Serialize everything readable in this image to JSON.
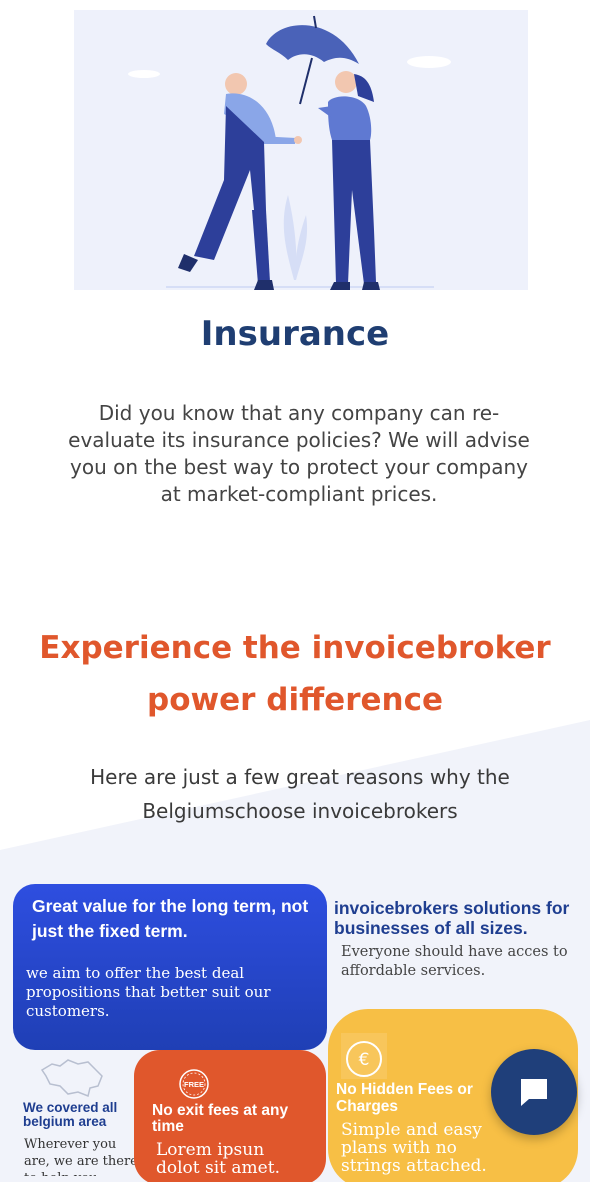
{
  "hero": {
    "illustration": "insurance-umbrella-illustration"
  },
  "insurance": {
    "title": "Insurance",
    "body": "Did you know that any company can re-evaluate its insurance policies? We will advise you on the best way to protect your company at market-compliant prices."
  },
  "experience": {
    "title_line1": "Experience the invoicebroker",
    "title_line2": "power difference",
    "subtitle_line1": "Here are just a few great reasons why the",
    "subtitle_line2": "Belgiumschoose invoicebrokers"
  },
  "cards": {
    "value": {
      "title": "Great value for the long term, not just the fixed term.",
      "body": "we aim to offer the best deal propositions that better suit our customers."
    },
    "solutions": {
      "title": "invoicebrokers solutions for businesses of all sizes.",
      "body": "Everyone should have acces to affordable services."
    },
    "belgium": {
      "icon": "belgium-map-icon",
      "title": "We covered all belgium area",
      "body": "Wherever you are, we are there to help you."
    },
    "exit_fees": {
      "icon": "free-badge-icon",
      "badge_text": "FREE",
      "title": "No exit fees at any time",
      "body": "Lorem ipsun dolot sit amet."
    },
    "hidden_fees": {
      "icon": "euro-icon",
      "title": "No Hidden Fees or Charges",
      "body": "Simple and easy plans with no strings attached."
    }
  },
  "chat": {
    "icon": "chat-bubble-icon"
  },
  "colors": {
    "navy": "#1f3e72",
    "orange": "#e0572c",
    "blue": "#2e4ee0",
    "yellow": "#f7bf45"
  }
}
